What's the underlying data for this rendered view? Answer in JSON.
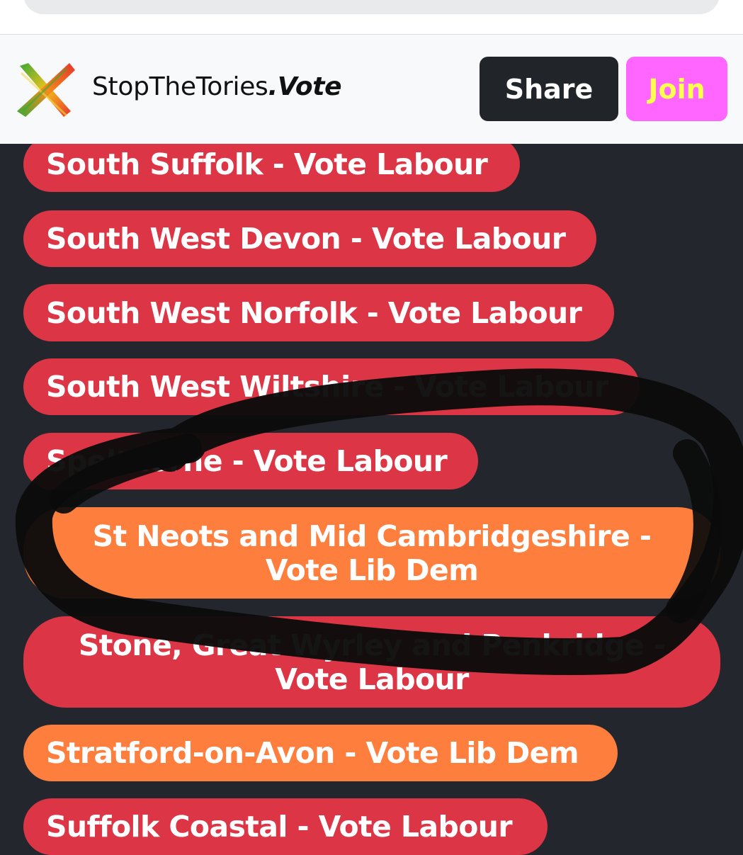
{
  "header": {
    "brand_main": "StopTheTories",
    "brand_suffix": ".Vote",
    "logo_icon": "x-logo-icon",
    "share_label": "Share",
    "join_label": "Join"
  },
  "colors": {
    "labour": "#dc3545",
    "libdem": "#fd7e3d",
    "join_bg": "#ff66ff",
    "join_text": "#ffff4d",
    "share_bg": "#212529",
    "page_bg": "#23272d"
  },
  "constituencies": [
    {
      "label": "South Suffolk - Vote Labour",
      "party": "labour"
    },
    {
      "label": "South West Devon - Vote Labour",
      "party": "labour"
    },
    {
      "label": "South West Norfolk - Vote Labour",
      "party": "labour"
    },
    {
      "label": "South West Wiltshire - Vote Labour",
      "party": "labour"
    },
    {
      "label": "Spelthorne - Vote Labour",
      "party": "labour"
    },
    {
      "label": "St Neots and Mid Cambridgeshire - Vote Lib Dem",
      "party": "libdem"
    },
    {
      "label": "Stone, Great Wyrley and Penkridge - Vote Labour",
      "party": "labour"
    },
    {
      "label": "Stratford-on-Avon - Vote Lib Dem",
      "party": "libdem"
    },
    {
      "label": "Suffolk Coastal - Vote Labour",
      "party": "labour"
    }
  ]
}
